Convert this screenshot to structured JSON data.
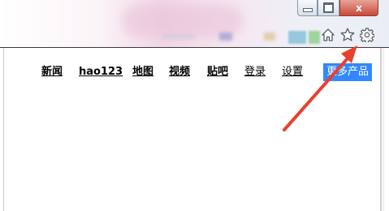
{
  "window": {
    "close_glyph": "x"
  },
  "toolbar": {
    "icons": [
      "home-icon",
      "star-icon",
      "gear-icon"
    ]
  },
  "nav": {
    "links": [
      "新闻",
      "hao123",
      "地图",
      "视频",
      "贴吧",
      "登录",
      "设置"
    ],
    "more_button": "更多产品"
  },
  "annotation": {
    "type": "red-arrow",
    "points_to": "gear-icon",
    "color": "#e8402e"
  }
}
